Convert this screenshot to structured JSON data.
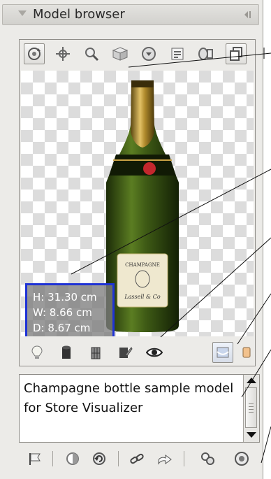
{
  "panel": {
    "title": "Model browser"
  },
  "toolbar": {
    "items": [
      {
        "icon": "orbit-icon",
        "active": true
      },
      {
        "icon": "pan-icon",
        "active": false
      },
      {
        "icon": "zoom-icon",
        "active": false
      },
      {
        "icon": "view-cube-icon",
        "active": false
      },
      {
        "icon": "target-icon",
        "active": false
      },
      {
        "icon": "properties-list-icon",
        "active": false
      },
      {
        "icon": "light-icon",
        "active": false
      },
      {
        "icon": "copy-icon",
        "active": true
      }
    ]
  },
  "model": {
    "name": "Champagne bottle",
    "label_brand": "CHAMPAGNE",
    "label_maker": "Lassell & Co"
  },
  "dimensions": {
    "height": "H: 31.30 cm",
    "width": "W: 8.66 cm",
    "depth": "D: 8.67 cm"
  },
  "render_toolbar": {
    "items": [
      {
        "icon": "bulb-icon",
        "active": false
      },
      {
        "icon": "solid-shading-icon",
        "active": false
      },
      {
        "icon": "wireframe-shading-icon",
        "active": false
      },
      {
        "icon": "texture-icon",
        "active": false
      },
      {
        "icon": "eye-icon",
        "active": false
      },
      {
        "icon": "background-toggle-icon",
        "active": true
      },
      {
        "icon": "color-swatch-icon",
        "active": false
      }
    ]
  },
  "description": {
    "text": "Champagne bottle sample model for Store Visualizer"
  },
  "bottom_toolbar": {
    "items": [
      {
        "icon": "flag-icon"
      },
      {
        "icon": "contrast-icon"
      },
      {
        "icon": "refresh-icon"
      },
      {
        "icon": "link-icon"
      },
      {
        "icon": "import-icon"
      },
      {
        "icon": "group-icon"
      },
      {
        "icon": "sphere-icon"
      }
    ]
  },
  "colors": {
    "panel_bg": "#ecebe8",
    "dims_border": "#1f33d6",
    "bottle_glass": "#3e5a15",
    "bottle_foil": "#b08b2c"
  }
}
